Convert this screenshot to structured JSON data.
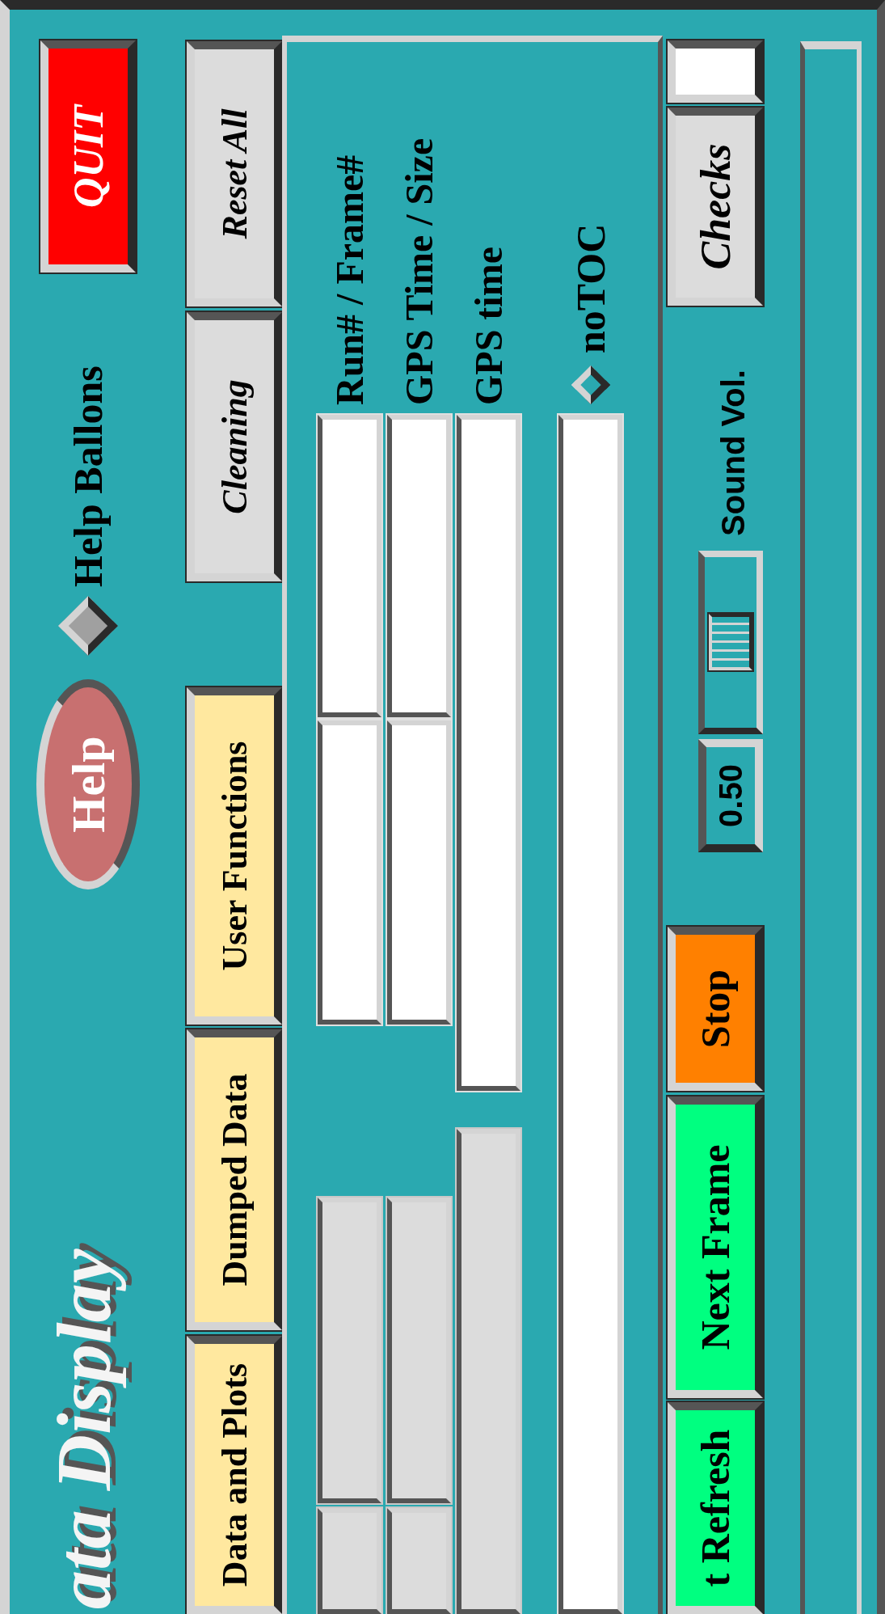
{
  "title": "ata Display",
  "help_button": "Help",
  "help_balloons": {
    "label": "Help Ballons",
    "on": false
  },
  "quit_button": "QUIT",
  "menu_buttons": [
    {
      "label": "Data and Plots",
      "kind": "menu"
    },
    {
      "label": "Dumped Data",
      "kind": "menu"
    },
    {
      "label": "User Functions",
      "kind": "menu"
    },
    {
      "label": "Cleaning",
      "kind": "action"
    },
    {
      "label": "Reset All",
      "kind": "action"
    }
  ],
  "field_rows": [
    {
      "label": "Run# / Frame#",
      "fields": [
        {
          "disabled": true
        },
        {
          "disabled": true
        },
        {
          "disabled": false
        },
        {
          "disabled": false
        }
      ]
    },
    {
      "label": "GPS Time / Size",
      "fields": [
        {
          "disabled": true
        },
        {
          "disabled": true
        },
        {
          "disabled": false
        },
        {
          "disabled": false
        }
      ]
    },
    {
      "label": "GPS time",
      "fields": [
        {
          "disabled": true
        },
        {
          "disabled": false
        }
      ]
    }
  ],
  "toc": {
    "label": "noTOC",
    "on": false
  },
  "controls": [
    {
      "label": "t Refresh",
      "color": "#00ff80"
    },
    {
      "label": "Next Frame",
      "color": "#00ff80"
    },
    {
      "label": "Stop",
      "color": "#ff8000"
    }
  ],
  "volume": {
    "reading": "0.50",
    "level": 0.5,
    "label": "Sound Vol."
  },
  "checks_button": "Checks"
}
